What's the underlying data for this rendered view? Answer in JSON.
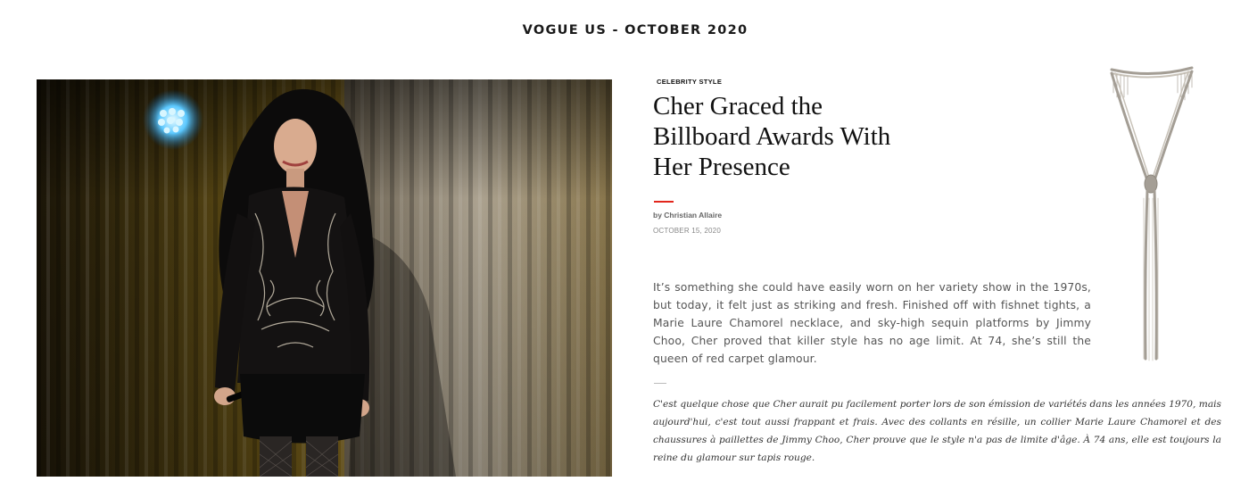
{
  "header": {
    "title": "VOGUE US - OCTOBER 2020"
  },
  "hero_image": {
    "alt": "Cher on stage in a black sequin-fringed outfit in front of a gold curtain"
  },
  "article": {
    "category": "CELEBRITY STYLE",
    "headline_lines": [
      "Cher Graced the",
      "Billboard Awards With",
      "Her Presence"
    ],
    "byline": "by Christian Allaire",
    "date": "OCTOBER 15, 2020",
    "body": "It’s something she could have easily worn on her variety show in the 1970s, but today, it felt just as striking and fresh. Finished off with fishnet tights, a Marie Laure Chamorel necklace, and sky-high sequin platforms by Jimmy Choo, Cher proved that killer style has no age limit. At 74, she’s still the queen of red carpet glamour.",
    "translation": "C'est quelque chose que Cher aurait pu facilement porter lors de son émission de variétés dans les années 1970, mais aujourd'hui, c'est tout aussi frappant et frais. Avec des collants en résille, un collier Marie Laure Chamorel et des chaussures à paillettes de Jimmy Choo, Cher prouve que le style n'a pas de limite d'âge. À 74 ans, elle est toujours la reine du glamour sur tapis rouge."
  },
  "product_image": {
    "alt": "Marie Laure Chamorel silver fringe necklace"
  },
  "colors": {
    "accent_rule": "#e2261c",
    "curtain_gold": "#b8902e",
    "curtain_silver": "#a9a39a"
  }
}
